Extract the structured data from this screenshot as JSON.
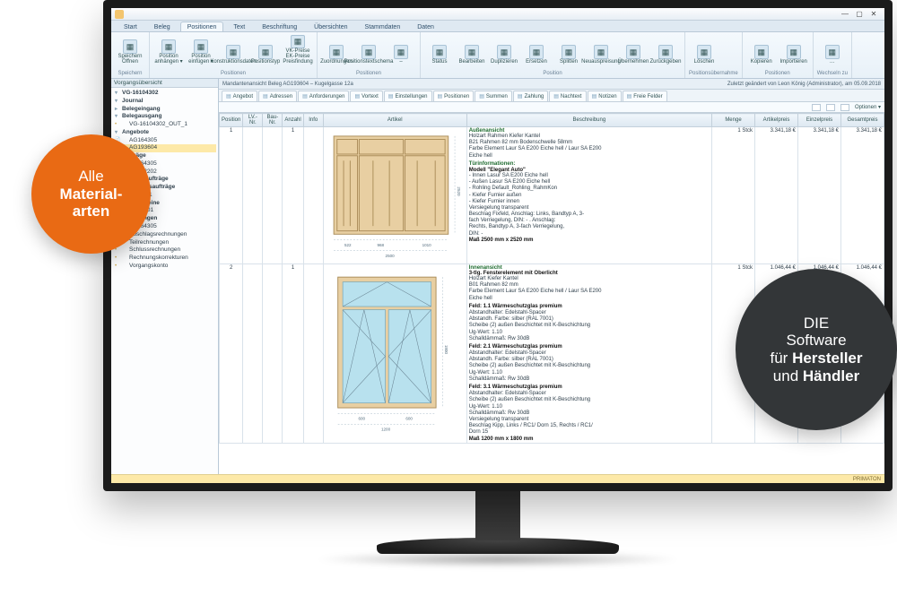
{
  "window": {
    "min": "—",
    "max": "▢",
    "close": "✕"
  },
  "tabs": [
    "Start",
    "Beleg",
    "Positionen",
    "Text",
    "Beschriftung",
    "Übersichten",
    "Stammdaten",
    "Daten"
  ],
  "activeTab": 2,
  "ribbon": {
    "groups": [
      {
        "title": "Speichern",
        "buttons": [
          "Speichern Öffnen"
        ]
      },
      {
        "title": "Positionen",
        "buttons": [
          "Position anhängen ▾",
          "Position einfügen ▾",
          "Konstruktionsdaten",
          "Positionstyp",
          "VK-Preise EK-Preise Preisfindung"
        ]
      },
      {
        "title": "Positionen",
        "buttons": [
          "Zuordnungen",
          "Positionstextschema",
          "–"
        ]
      },
      {
        "title": "Position",
        "buttons": [
          "Status",
          "Bearbeiten",
          "Duplizieren",
          "Ersetzen",
          "Splitten",
          "Neuauspreisung",
          "Übernehmen",
          "Zurückgeben"
        ]
      },
      {
        "title": "Positionsübernahme",
        "buttons": [
          "Löschen"
        ]
      },
      {
        "title": "Positionen",
        "buttons": [
          "Kopieren",
          "Importieren"
        ]
      },
      {
        "title": "Wechseln zu",
        "buttons": [
          "…"
        ]
      }
    ]
  },
  "sidebar": {
    "title": "Vorgangsübersicht",
    "root": "VG-16104302",
    "items": [
      {
        "l": "Journal",
        "cls": "bold open"
      },
      {
        "l": "Belegeingang",
        "cls": "bold"
      },
      {
        "l": "Belegausgang",
        "cls": "bold open"
      },
      {
        "l": "VG-16104302_OUT_1",
        "cls": "leaf"
      },
      {
        "l": "Angebote",
        "cls": "bold open"
      },
      {
        "l": "AG164305",
        "cls": "doc"
      },
      {
        "l": "AG193604",
        "cls": "doc sel"
      },
      {
        "l": "Aufträge",
        "cls": "bold open"
      },
      {
        "l": "AU164305",
        "cls": "doc"
      },
      {
        "l": "AU172202",
        "cls": "doc"
      },
      {
        "l": "Betriebsaufträge",
        "cls": "bold"
      },
      {
        "l": "Fertigungsaufträge",
        "cls": "bold open"
      },
      {
        "l": "F164401",
        "cls": "doc"
      },
      {
        "l": "Lieferscheine",
        "cls": "bold open"
      },
      {
        "l": "LI164901",
        "cls": "doc"
      },
      {
        "l": "Rechnungen",
        "cls": "bold open"
      },
      {
        "l": "RE164305",
        "cls": "doc"
      },
      {
        "l": "Abschlagsrechnungen",
        "cls": "leaf"
      },
      {
        "l": "Teilrechnungen",
        "cls": "leaf"
      },
      {
        "l": "Schlussrechnungen",
        "cls": "leaf"
      },
      {
        "l": "Rechnungskorrekturen",
        "cls": "leaf"
      },
      {
        "l": "Vorgangskonto",
        "cls": "leaf"
      }
    ]
  },
  "crumb": {
    "left": "Mandantenansicht     Beleg AG193604 – Kugelgasse 12a",
    "right": "Zuletzt geändert von Leon König (Administrator), am 05.09.2018"
  },
  "docTabs": [
    "Angebot",
    "Adressen",
    "Anforderungen",
    "Vortext",
    "Einstellungen",
    "Positionen",
    "Summen",
    "Zahlung",
    "Nachtext",
    "Notizen",
    "Freie Felder"
  ],
  "activeDocTab": 5,
  "miniToolbar": {
    "options": "Optionen ▾"
  },
  "grid": {
    "headers": [
      "Position",
      "LV.-Nr.",
      "Bau-Nr.",
      "Anzahl",
      "Info",
      "Artikel",
      "Beschreibung",
      "Menge",
      "Artikelpreis",
      "Einzelpreis",
      "Gesamtpreis"
    ],
    "rows": [
      {
        "pos": "1",
        "lv": "",
        "bau": "",
        "anz": "1",
        "info": "",
        "menge": "1 Stck",
        "artpr": "3.341,18 €",
        "einzel": "3.341,18 €",
        "gesamt": "3.341,18 €",
        "title": "Außenansicht",
        "lines": [
          "Holzart Rahmen    Kiefer Kantel",
          "B21    Rahmen 82 mm Bodenschwelle 58mm",
          "Farbe Element   Laur SA E200 Eiche hell / Laur SA E200",
          "                 Eiche hell"
        ],
        "sub": "Türinformationen:",
        "sub2": "Modell \"Elegant Auto\"",
        "lines2": [
          "- Innen Lasur SA E200 Eiche hell",
          "- Außen Lasur SA E200 Eiche hell",
          "- Rohling Default_Rohling_RahmKon",
          "- Kiefer Furnier außen",
          "- Kiefer Furnier innen",
          "Versiegelung    transparent",
          "Beschlag    Fixfeld, Anschlag: Links, Bandtyp A, 3-",
          "            fach Verriegelung, DIN: - . Anschlag:",
          "            Rechts, Bandtyp A, 3-fach Verriegelung,",
          "            DIN: -",
          "Maß    2500 mm x 2520 mm"
        ],
        "dims": {
          "w": "2500",
          "cols": [
            "522",
            "968",
            "1010"
          ],
          "h": "2520"
        }
      },
      {
        "pos": "2",
        "lv": "",
        "bau": "",
        "anz": "1",
        "info": "",
        "menge": "1 Stck",
        "artpr": "1.046,44 €",
        "einzel": "1.046,44 €",
        "gesamt": "1.046,44 €",
        "title": "Innenansicht",
        "lines": [
          "3-tlg. Fensterelement mit Oberlicht",
          "Holzart      Kiefer Kantel",
          "B01    Rahmen 82 mm",
          "Farbe Element   Laur SA E200 Eiche hell / Laur SA E200",
          "                 Eiche hell",
          "",
          "Feld: 1.1 Wärmeschutzglas premium",
          "Abstandhalter: Edelstahl-Spacer",
          "Abstandh. Farbe: silber (RAL 7001)",
          "Scheibe (2) außen Beschichtet mit K-Beschichtung",
          "Ug-Wert: 1.10",
          "Schalldämmaß: Rw 30dB",
          "Feld: 2.1 Wärmeschutzglas premium",
          "Abstandhalter: Edelstahl-Spacer",
          "Abstandh. Farbe: silber (RAL 7001)",
          "Scheibe (2) außen Beschichtet mit K-Beschichtung",
          "Ug-Wert: 1.10",
          "Schalldämmaß: Rw 30dB",
          "Feld: 3.1 Wärmeschutzglas premium",
          "Abstandhalter: Edelstahl-Spacer",
          "Scheibe (2) außen Beschichtet mit K-Beschichtung",
          "Ug-Wert: 1.10",
          "Schalldämmaß: Rw 30dB",
          "Versiegelung   transparent",
          "Beschlag    Kipp, Links / RC1/ Dorn 15, Rechts / RC1/",
          "            Dorn 15",
          "Maß    1200 mm x 1800 mm"
        ],
        "dims": {
          "w": "1200",
          "cols": [
            "600",
            "600"
          ],
          "h": "1800"
        }
      }
    ]
  },
  "status": "PRIMATON",
  "badges": {
    "orange_l1": "Alle",
    "orange_l2": "Material-",
    "orange_l3": "arten",
    "dark_l1": "DIE",
    "dark_l2": "Software",
    "dark_l3a": "für ",
    "dark_l3b": "Hersteller",
    "dark_l4a": "und ",
    "dark_l4b": "Händler"
  }
}
